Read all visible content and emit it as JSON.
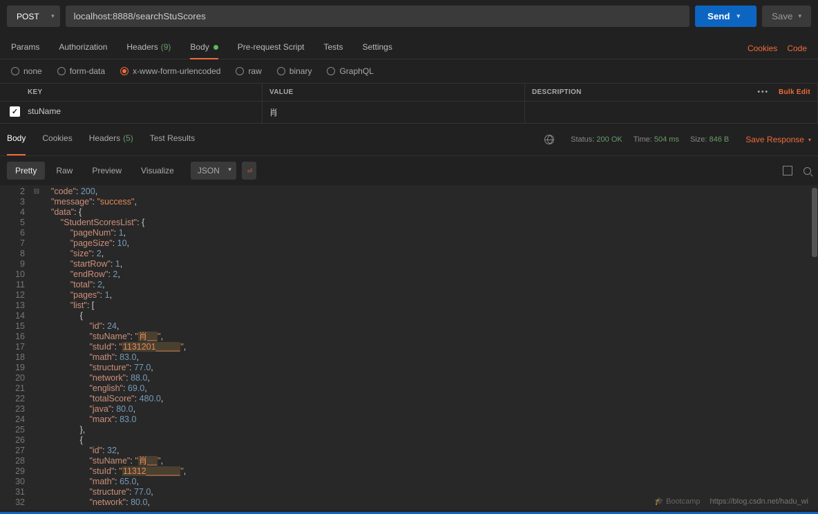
{
  "request": {
    "method": "POST",
    "url": "localhost:8888/searchStuScores",
    "send_label": "Send",
    "save_label": "Save"
  },
  "tabs": {
    "params": "Params",
    "auth": "Authorization",
    "headers": "Headers",
    "headers_count": "(9)",
    "body": "Body",
    "prereq": "Pre-request Script",
    "tests": "Tests",
    "settings": "Settings",
    "cookies_link": "Cookies",
    "code_link": "Code"
  },
  "body_types": {
    "none": "none",
    "formdata": "form-data",
    "xwww": "x-www-form-urlencoded",
    "raw": "raw",
    "binary": "binary",
    "graphql": "GraphQL"
  },
  "params_table": {
    "h_key": "KEY",
    "h_val": "VALUE",
    "h_desc": "DESCRIPTION",
    "bulk": "Bulk Edit",
    "r1_key": "stuName",
    "r1_val": "肖"
  },
  "res_tabs": {
    "body": "Body",
    "cookies": "Cookies",
    "headers": "Headers",
    "headers_count": "(5)",
    "tests": "Test Results"
  },
  "status_line": {
    "status_lbl": "Status:",
    "status_val": "200 OK",
    "time_lbl": "Time:",
    "time_val": "504 ms",
    "size_lbl": "Size:",
    "size_val": "846 B",
    "save_resp": "Save Response"
  },
  "pretty_tabs": {
    "pretty": "Pretty",
    "raw": "Raw",
    "preview": "Preview",
    "visualize": "Visualize",
    "fmt": "JSON"
  },
  "watermark": "https://blog.csdn.net/hadu_wi",
  "bootcamp": "Bootcamp",
  "response_body": {
    "code": 200,
    "message": "success",
    "data": {
      "StudentScoresList": {
        "pageNum": 1,
        "pageSize": 10,
        "size": 2,
        "startRow": 1,
        "endRow": 2,
        "total": 2,
        "pages": 1,
        "list": [
          {
            "id": 24,
            "stuName": "肖__",
            "stuId": "1131201_____",
            "math": 83.0,
            "structure": 77.0,
            "network": 88.0,
            "english": 69.0,
            "totalScore": 480.0,
            "java": 80.0,
            "marx": 83.0
          },
          {
            "id": 32,
            "stuName": "肖__",
            "stuId": "11312_______",
            "math": 65.0,
            "structure": 77.0,
            "network": 80.0
          }
        ]
      }
    }
  }
}
